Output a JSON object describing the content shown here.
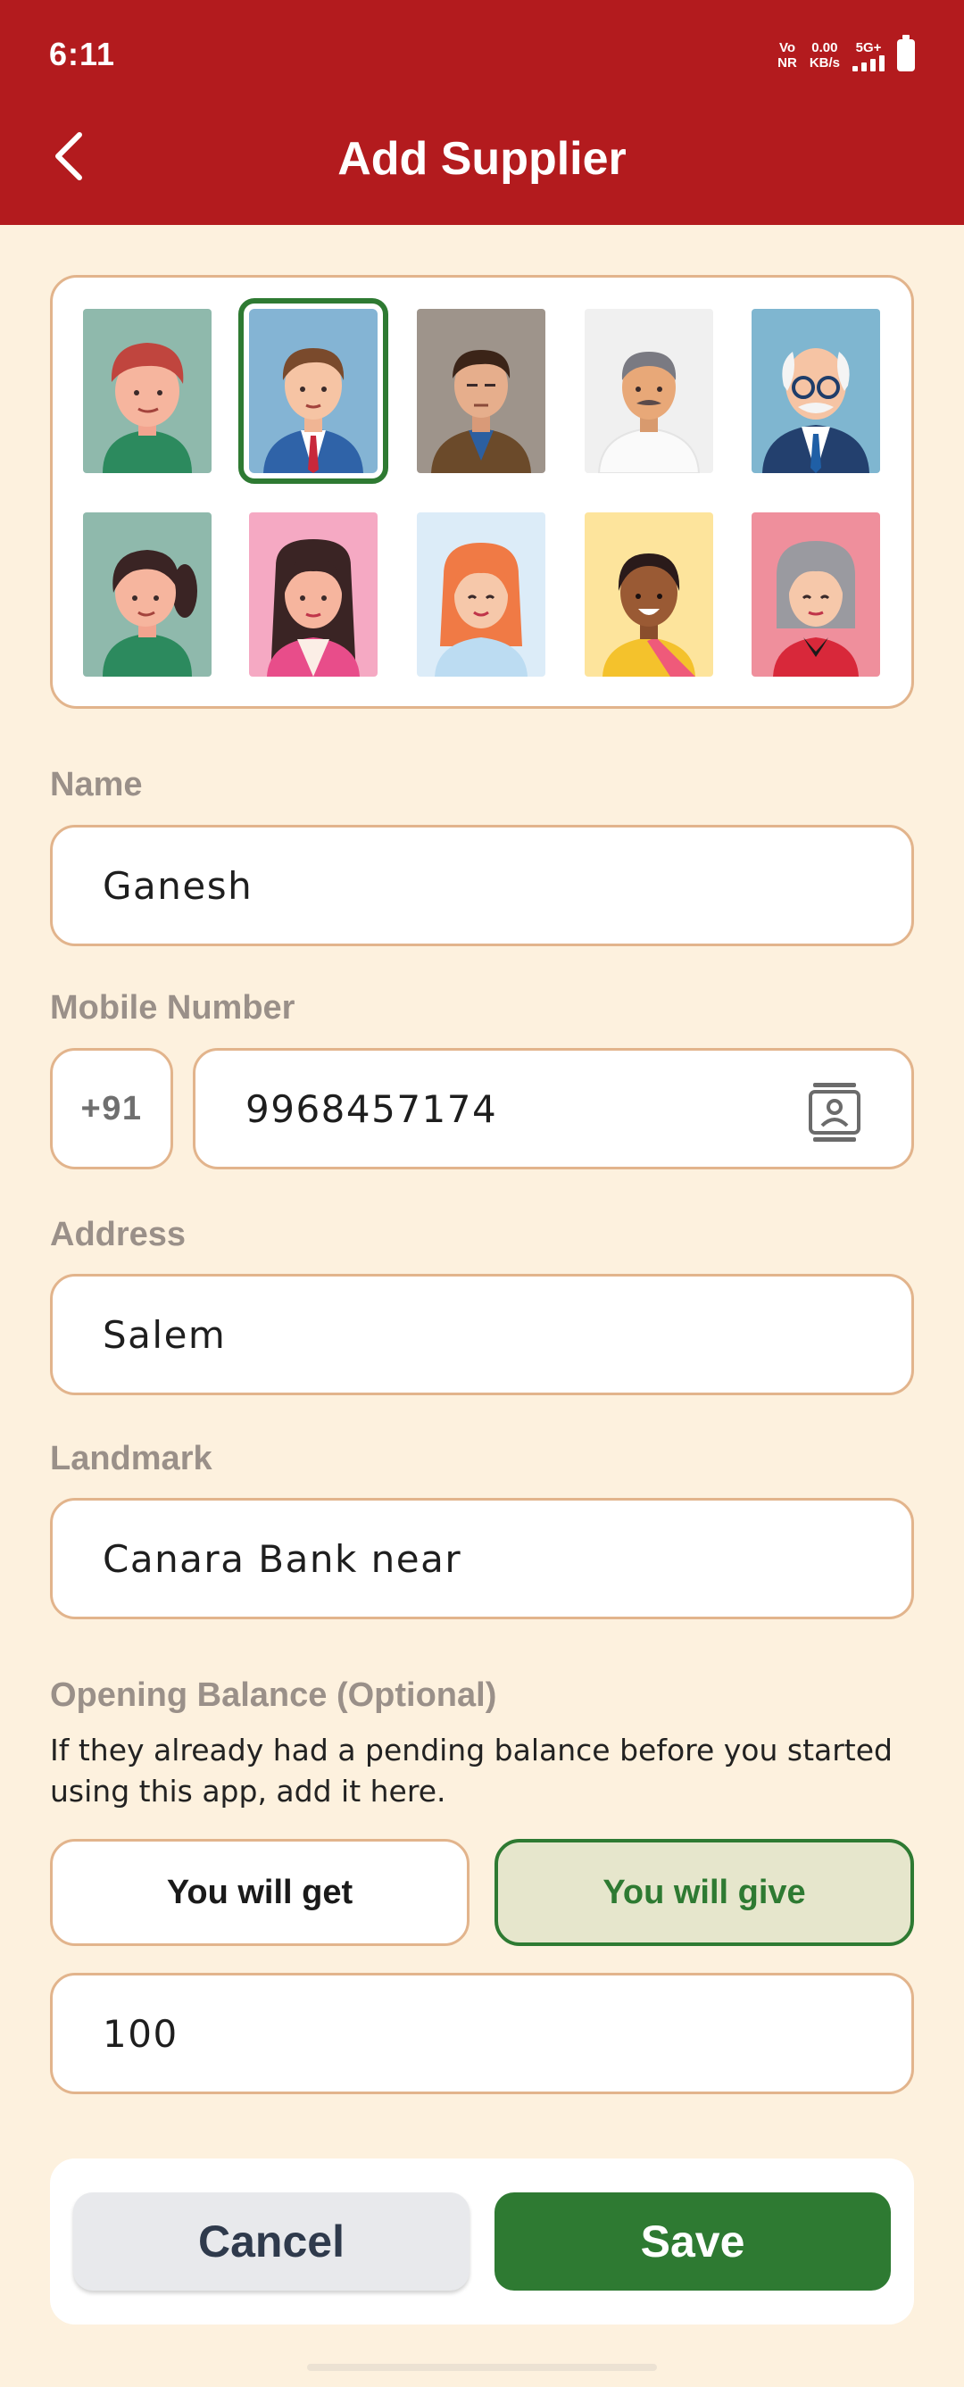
{
  "status_bar": {
    "time": "6:11",
    "network_vo": "Vo",
    "network_nr": "NR",
    "speed_value": "0.00",
    "speed_unit": "KB/s",
    "network_type": "5G+"
  },
  "header": {
    "title": "Add Supplier",
    "background": "#b31b1e"
  },
  "avatars": {
    "selected_index": 1,
    "items": [
      {
        "name": "boy-red-hair",
        "bg": "#8fb9ac"
      },
      {
        "name": "man-suit-red-tie",
        "bg": "#84b4d4"
      },
      {
        "name": "man-brown-jacket",
        "bg": "#9e948b"
      },
      {
        "name": "man-mustache-white-shirt",
        "bg": "#f0f0f0"
      },
      {
        "name": "old-man-glasses",
        "bg": "#7fb6d0"
      },
      {
        "name": "girl-ponytail",
        "bg": "#8fb9ac"
      },
      {
        "name": "woman-dark-hair-pink",
        "bg": "#f5a9c3"
      },
      {
        "name": "woman-red-hair",
        "bg": "#dcecf8"
      },
      {
        "name": "woman-saree",
        "bg": "#fde49c"
      },
      {
        "name": "old-woman-grey-hair",
        "bg": "#ef8f9c"
      }
    ]
  },
  "form": {
    "name_label": "Name",
    "name_value": "Ganesh",
    "mobile_label": "Mobile Number",
    "country_code": "+91",
    "mobile_value": "9968457174",
    "address_label": "Address",
    "address_value": "Salem",
    "landmark_label": "Landmark",
    "landmark_value": "Canara Bank near",
    "opening_label": "Opening Balance (Optional)",
    "opening_hint": "If they already had a pending balance before you started using this app, add it here.",
    "get_label": "You will get",
    "give_label": "You will give",
    "selected_direction": "give",
    "amount_value": "100"
  },
  "actions": {
    "cancel_label": "Cancel",
    "save_label": "Save"
  },
  "colors": {
    "accent_green": "#2e7a32",
    "field_border": "#e2b48c",
    "page_bg": "#fdf1de"
  }
}
